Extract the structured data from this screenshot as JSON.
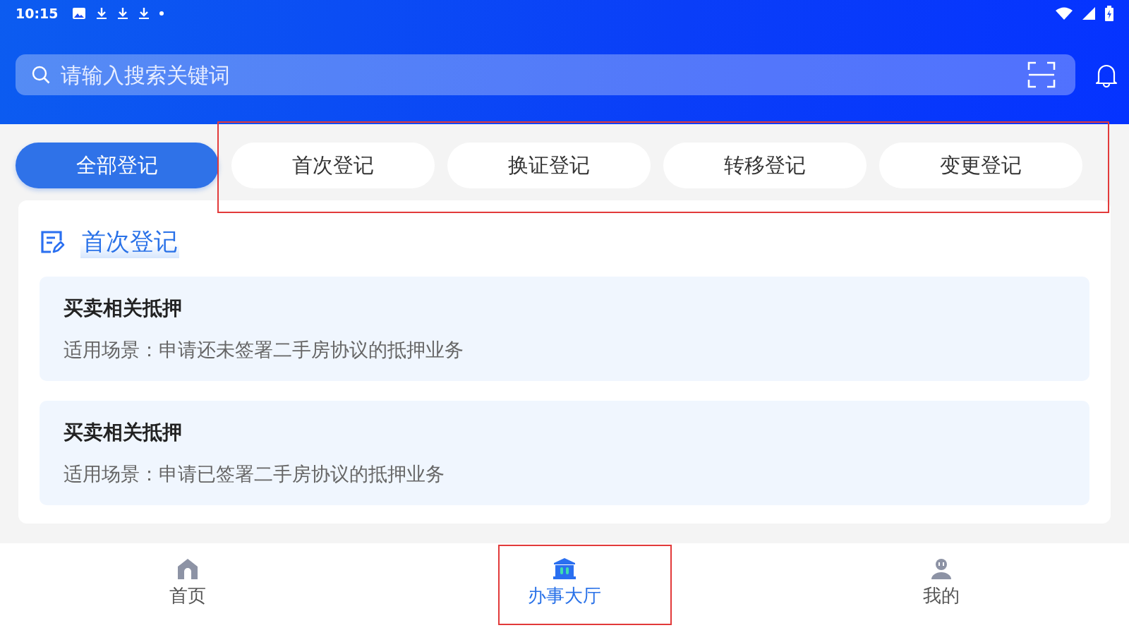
{
  "status_bar": {
    "time": "10:15"
  },
  "search": {
    "placeholder": "请输入搜索关键词"
  },
  "tab_bar": {
    "highlighted": true,
    "tabs": [
      {
        "label": "全部登记",
        "selected": true
      },
      {
        "label": "首次登记",
        "selected": false
      },
      {
        "label": "换证登记",
        "selected": false
      },
      {
        "label": "转移登记",
        "selected": false
      },
      {
        "label": "变更登记",
        "selected": false
      }
    ]
  },
  "section": {
    "title": "首次登记",
    "items": [
      {
        "title": "买卖相关抵押",
        "description": "适用场景：申请还未签署二手房协议的抵押业务"
      },
      {
        "title": "买卖相关抵押",
        "description": "适用场景：申请已签署二手房协议的抵押业务"
      }
    ]
  },
  "bottom_nav": [
    {
      "kind": "home",
      "label": "首页",
      "selected": false,
      "highlighted": false
    },
    {
      "kind": "hall",
      "label": "办事大厅",
      "selected": true,
      "highlighted": true
    },
    {
      "kind": "profile",
      "label": "我的",
      "selected": false,
      "highlighted": false
    }
  ]
}
